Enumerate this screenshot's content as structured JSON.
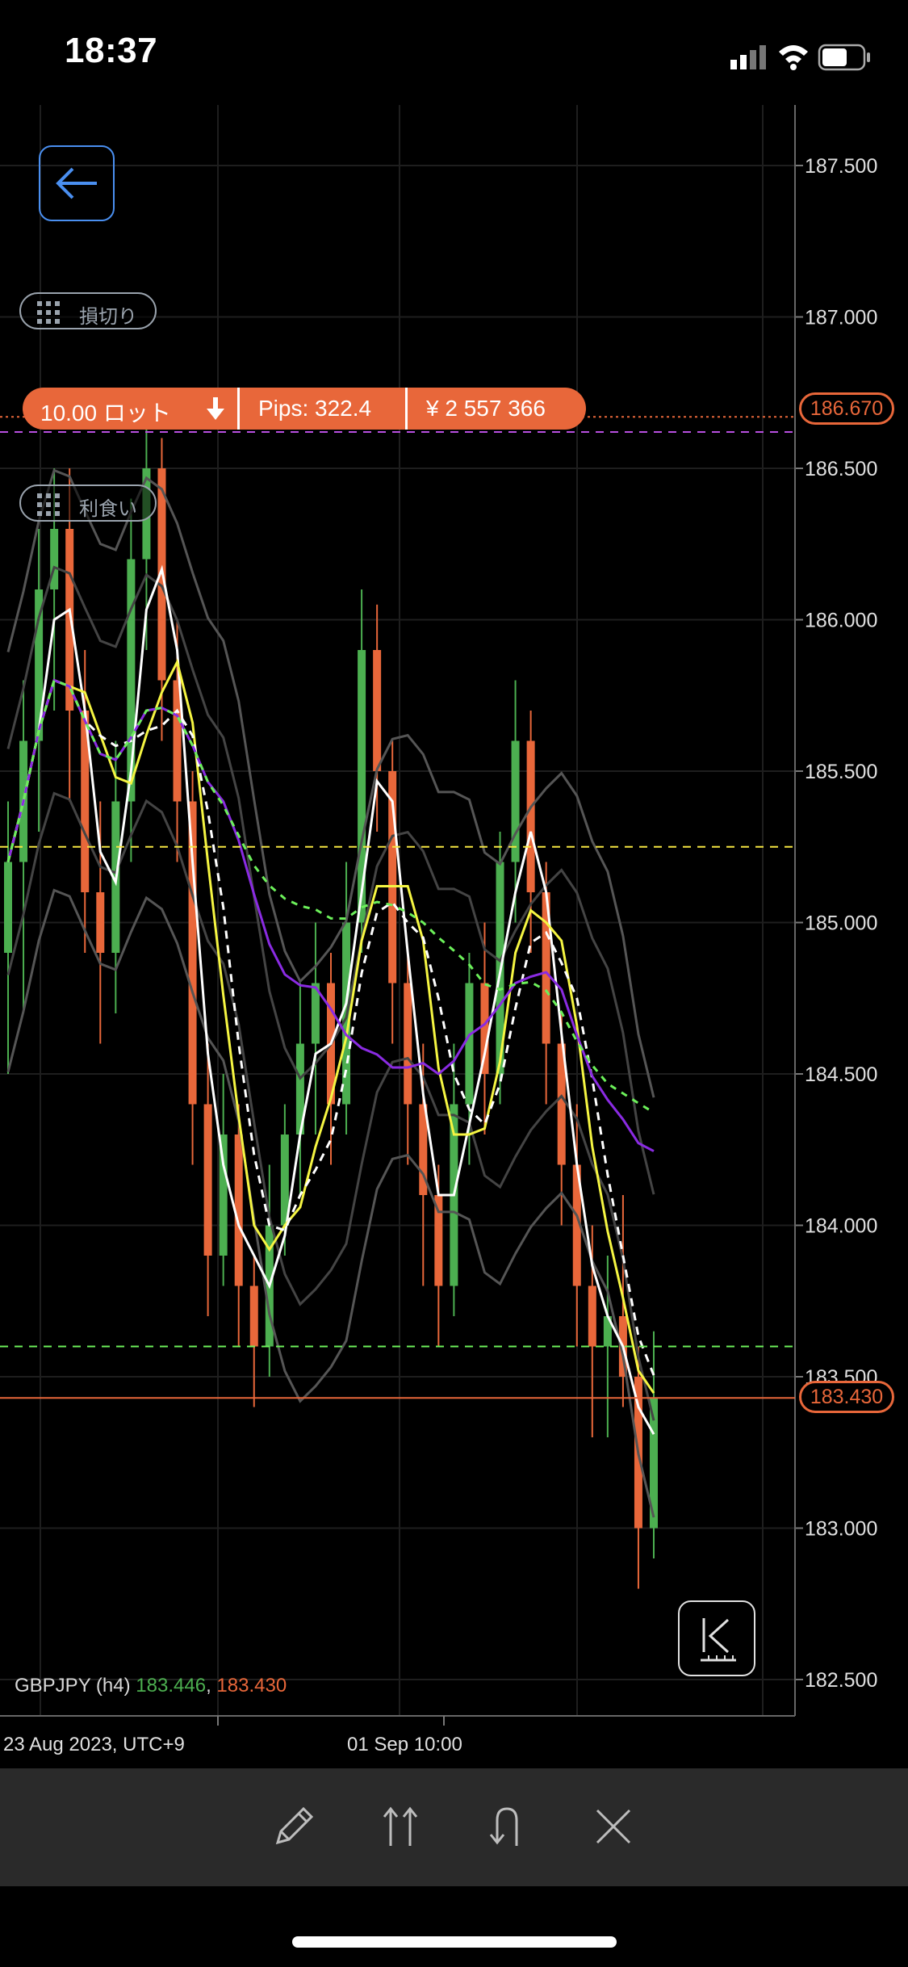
{
  "status": {
    "time": "18:37"
  },
  "order": {
    "lots": "10.00 ロット",
    "pips": "Pips: 322.4",
    "amount": "¥ 2 557 366",
    "order_price": "186.670",
    "current_price": "183.430"
  },
  "labels": {
    "stop_loss": "損切り",
    "take_profit": "利食い"
  },
  "symbol": {
    "name": "GBPJPY (h4)",
    "bid": "183.446",
    "sep": ",",
    "ask": "183.430"
  },
  "time_axis": {
    "label_1": "23 Aug 2023, UTC+9",
    "label_2": "01 Sep 10:00"
  },
  "chart_data": {
    "type": "candlestick",
    "symbol": "GBPJPY",
    "timeframe": "h4",
    "y_axis_labels": [
      "187.500",
      "187.000",
      "186.500",
      "186.000",
      "185.500",
      "185.000",
      "184.500",
      "184.000",
      "183.500",
      "183.000",
      "182.500"
    ],
    "ylim": [
      182.38,
      187.7
    ],
    "horizontal_lines": [
      {
        "price": 186.67,
        "color": "#e8673a",
        "style": "dotted"
      },
      {
        "price": 186.62,
        "color": "#b84fe0",
        "style": "dashed"
      },
      {
        "price": 185.25,
        "color": "#f5e642",
        "style": "dashed"
      },
      {
        "price": 183.6,
        "color": "#6cf05a",
        "style": "dashed"
      },
      {
        "price": 183.43,
        "color": "#e8673a",
        "style": "solid"
      }
    ],
    "candles": [
      {
        "o": 184.9,
        "h": 185.4,
        "l": 184.5,
        "c": 185.2
      },
      {
        "o": 185.2,
        "h": 185.8,
        "l": 184.7,
        "c": 185.6
      },
      {
        "o": 185.6,
        "h": 186.3,
        "l": 185.3,
        "c": 186.1
      },
      {
        "o": 186.1,
        "h": 186.5,
        "l": 185.7,
        "c": 186.3
      },
      {
        "o": 186.3,
        "h": 186.5,
        "l": 185.4,
        "c": 185.7
      },
      {
        "o": 185.7,
        "h": 185.9,
        "l": 184.9,
        "c": 185.1
      },
      {
        "o": 185.1,
        "h": 185.4,
        "l": 184.6,
        "c": 184.9
      },
      {
        "o": 184.9,
        "h": 185.6,
        "l": 184.7,
        "c": 185.4
      },
      {
        "o": 185.4,
        "h": 186.4,
        "l": 185.2,
        "c": 186.2
      },
      {
        "o": 186.2,
        "h": 186.75,
        "l": 185.9,
        "c": 186.5
      },
      {
        "o": 186.5,
        "h": 186.6,
        "l": 185.6,
        "c": 185.8
      },
      {
        "o": 185.8,
        "h": 186.0,
        "l": 185.2,
        "c": 185.4
      },
      {
        "o": 185.4,
        "h": 185.5,
        "l": 184.2,
        "c": 184.4
      },
      {
        "o": 184.4,
        "h": 184.6,
        "l": 183.7,
        "c": 183.9
      },
      {
        "o": 183.9,
        "h": 184.5,
        "l": 183.8,
        "c": 184.3
      },
      {
        "o": 184.3,
        "h": 184.4,
        "l": 183.6,
        "c": 183.8
      },
      {
        "o": 183.8,
        "h": 183.9,
        "l": 183.4,
        "c": 183.6
      },
      {
        "o": 183.6,
        "h": 184.2,
        "l": 183.5,
        "c": 184.0
      },
      {
        "o": 184.0,
        "h": 184.4,
        "l": 183.9,
        "c": 184.3
      },
      {
        "o": 184.3,
        "h": 184.8,
        "l": 184.1,
        "c": 184.6
      },
      {
        "o": 184.6,
        "h": 185.0,
        "l": 184.3,
        "c": 184.8
      },
      {
        "o": 184.8,
        "h": 184.9,
        "l": 184.2,
        "c": 184.4
      },
      {
        "o": 184.4,
        "h": 185.2,
        "l": 184.3,
        "c": 185.0
      },
      {
        "o": 185.0,
        "h": 186.1,
        "l": 184.9,
        "c": 185.9
      },
      {
        "o": 185.9,
        "h": 186.05,
        "l": 185.3,
        "c": 185.5
      },
      {
        "o": 185.5,
        "h": 185.6,
        "l": 184.6,
        "c": 184.8
      },
      {
        "o": 184.8,
        "h": 184.9,
        "l": 184.2,
        "c": 184.4
      },
      {
        "o": 184.4,
        "h": 184.6,
        "l": 183.8,
        "c": 184.1
      },
      {
        "o": 184.1,
        "h": 184.2,
        "l": 183.6,
        "c": 183.8
      },
      {
        "o": 183.8,
        "h": 184.6,
        "l": 183.7,
        "c": 184.4
      },
      {
        "o": 184.4,
        "h": 184.9,
        "l": 184.2,
        "c": 184.8
      },
      {
        "o": 184.8,
        "h": 185.0,
        "l": 184.3,
        "c": 184.5
      },
      {
        "o": 184.5,
        "h": 185.3,
        "l": 184.4,
        "c": 185.2
      },
      {
        "o": 185.2,
        "h": 185.8,
        "l": 185.0,
        "c": 185.6
      },
      {
        "o": 185.6,
        "h": 185.7,
        "l": 184.9,
        "c": 185.1
      },
      {
        "o": 185.1,
        "h": 185.2,
        "l": 184.4,
        "c": 184.6
      },
      {
        "o": 184.6,
        "h": 184.7,
        "l": 184.0,
        "c": 184.2
      },
      {
        "o": 184.2,
        "h": 184.4,
        "l": 183.6,
        "c": 183.8
      },
      {
        "o": 183.8,
        "h": 184.0,
        "l": 183.3,
        "c": 183.6
      },
      {
        "o": 183.6,
        "h": 183.9,
        "l": 183.3,
        "c": 183.7
      },
      {
        "o": 183.7,
        "h": 184.1,
        "l": 183.4,
        "c": 183.5
      },
      {
        "o": 183.5,
        "h": 183.6,
        "l": 182.8,
        "c": 183.0
      },
      {
        "o": 183.0,
        "h": 183.65,
        "l": 182.9,
        "c": 183.43
      }
    ]
  },
  "toolbar": {
    "edit_icon": "pencil-icon",
    "partial_icon": "double-up-arrow-icon",
    "reverse_icon": "u-turn-icon",
    "close_icon": "close-x-icon"
  },
  "colors": {
    "accent": "#e8673a",
    "bull": "#4caf50",
    "bear": "#e8673a",
    "grid": "#1e1e1e",
    "button_blue": "#4a8ff0"
  }
}
